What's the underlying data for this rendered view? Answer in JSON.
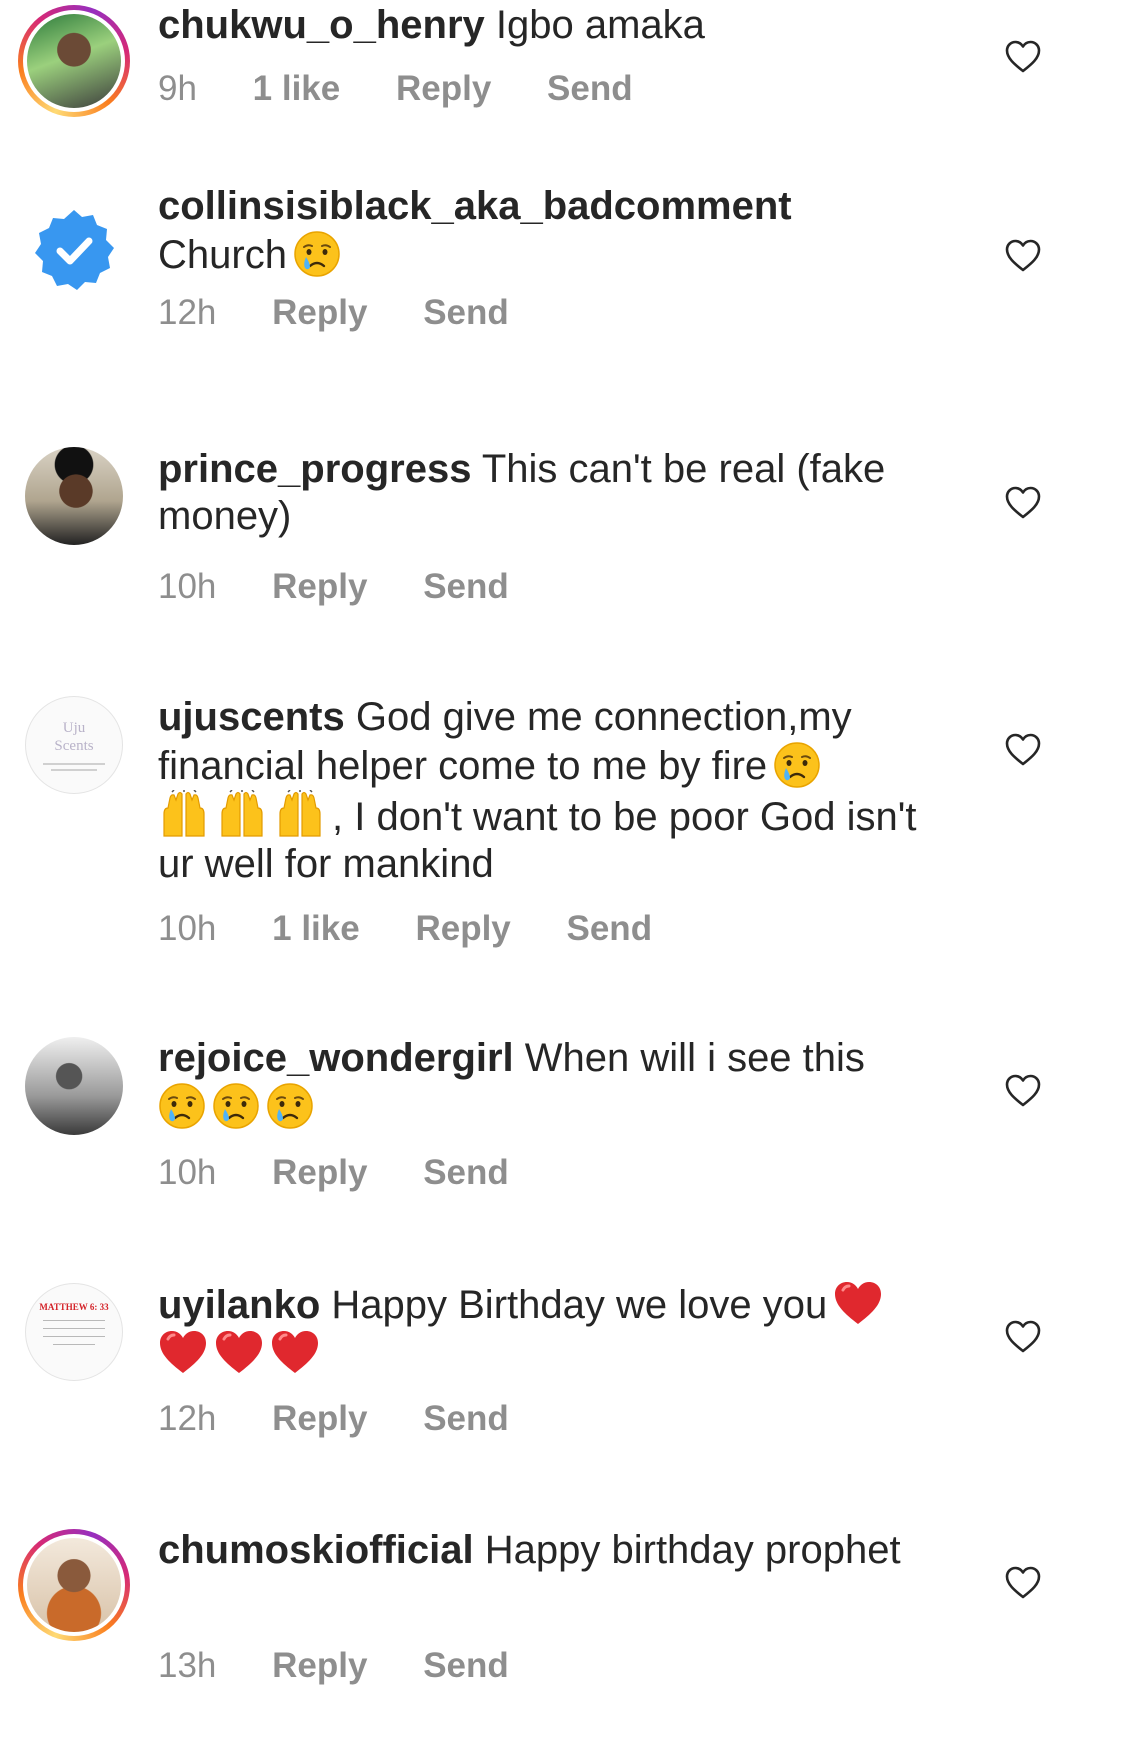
{
  "comments": [
    {
      "username": "chukwu_o_henry",
      "text": "Igbo amaka",
      "time": "9h",
      "likes": "1 like",
      "reply": "Reply",
      "send": "Send"
    },
    {
      "username": "collinsisiblack_aka_badcomment",
      "text": "Church",
      "time": "12h",
      "reply": "Reply",
      "send": "Send"
    },
    {
      "username": "prince_progress",
      "text": "This can't be real (fake money)",
      "time": "10h",
      "reply": "Reply",
      "send": "Send"
    },
    {
      "username": "ujuscents",
      "text": "God give me connection,my financial helper come to me by fire",
      "text2": ", I don't want to be poor God isn't ur well for mankind",
      "time": "10h",
      "likes": "1 like",
      "reply": "Reply",
      "send": "Send",
      "avatar_logo": "Uju Scents"
    },
    {
      "username": "rejoice_wondergirl",
      "text": "When will i see this",
      "time": "10h",
      "reply": "Reply",
      "send": "Send"
    },
    {
      "username": "uyilanko",
      "text": "Happy Birthday we love you",
      "time": "12h",
      "reply": "Reply",
      "send": "Send",
      "avatar_logo": "MATTHEW 6: 33"
    },
    {
      "username": "chumoskiofficial",
      "text": "Happy birthday prophet",
      "time": "13h",
      "reply": "Reply",
      "send": "Send"
    }
  ],
  "icons": {
    "like": "heart-outline-icon",
    "crying": "crying-face-emoji",
    "raised_hands": "raised-hands-emoji",
    "red_heart": "red-heart-emoji",
    "verified": "verified-badge-icon"
  },
  "colors": {
    "text": "#262626",
    "meta": "#8e8e8e",
    "verified_blue": "#3897f0",
    "heart_red": "#e0282e"
  }
}
